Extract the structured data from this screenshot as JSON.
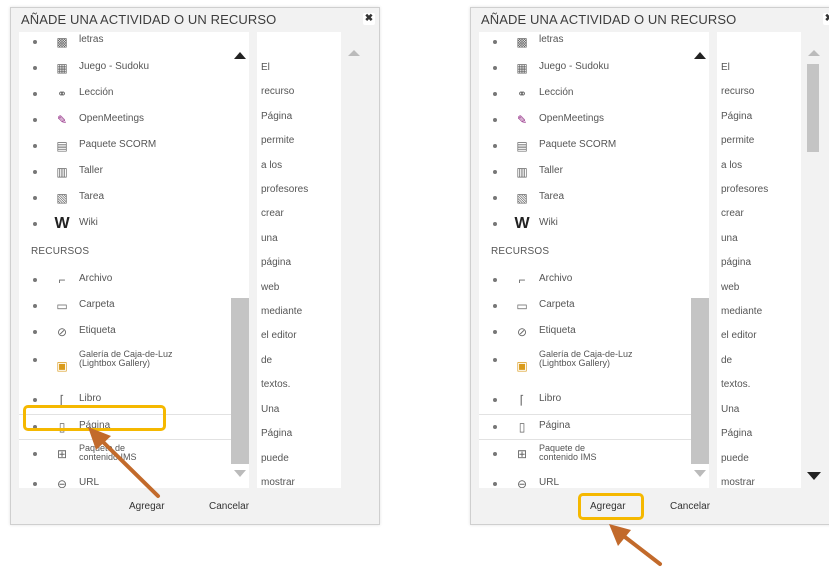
{
  "dialog_title": "AÑADE UNA ACTIVIDAD O UN RECURSO",
  "close_glyph": "✖",
  "top_partial_label": "letras",
  "activities": [
    {
      "label": "Juego - Sudoku",
      "icon": "sudoku-icon",
      "glyph": "▦"
    },
    {
      "label": "Lección",
      "icon": "lesson-icon",
      "glyph": "⚭"
    },
    {
      "label": "OpenMeetings",
      "icon": "openmeetings-icon",
      "glyph": "✎"
    },
    {
      "label": "Paquete SCORM",
      "icon": "scorm-package-icon",
      "glyph": "▤"
    },
    {
      "label": "Taller",
      "icon": "workshop-icon",
      "glyph": "▥"
    },
    {
      "label": "Tarea",
      "icon": "assignment-icon",
      "glyph": "▧"
    },
    {
      "label": "Wiki",
      "icon": "wiki-icon",
      "glyph": "W"
    }
  ],
  "resources_heading": "RECURSOS",
  "resources": [
    {
      "label": "Archivo",
      "icon": "file-icon",
      "glyph": "⌐"
    },
    {
      "label": "Carpeta",
      "icon": "folder-icon",
      "glyph": "▭"
    },
    {
      "label": "Etiqueta",
      "icon": "label-icon",
      "glyph": "⊘"
    },
    {
      "label": "Galería de Caja-de-Luz (Lightbox Gallery)",
      "icon": "gallery-icon",
      "glyph": "▣"
    },
    {
      "label": "Libro",
      "icon": "book-icon",
      "glyph": "⌈"
    },
    {
      "label": "Página",
      "icon": "page-icon",
      "glyph": "▯"
    },
    {
      "label": "Paquete de contenido IMS",
      "icon": "ims-package-icon",
      "glyph": "⊞"
    },
    {
      "label": "URL",
      "icon": "url-icon",
      "glyph": "⊖"
    }
  ],
  "description_words": [
    "El",
    "recurso",
    "Página",
    "permite",
    "a los",
    "profesores",
    "crear",
    "una",
    "página",
    "web",
    "mediante",
    "el editor",
    "de",
    "textos.",
    "Una",
    "Página",
    "puede",
    "mostrar"
  ],
  "buttons": {
    "add": "Agregar",
    "cancel": "Cancelar"
  },
  "colors": {
    "highlight": "#f5b800",
    "arrow": "#c26a2b"
  }
}
